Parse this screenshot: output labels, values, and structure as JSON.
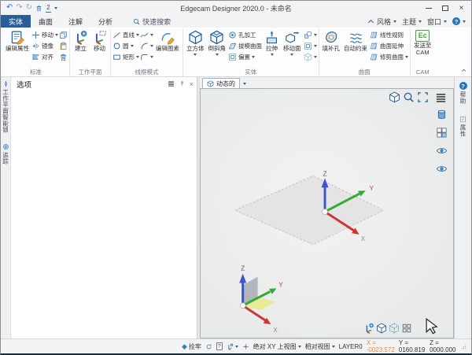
{
  "window": {
    "title": "Edgecam Designer 2020.0 - 未命名"
  },
  "icons": {
    "undo": "↶",
    "redo": "↷",
    "repeat": "↻",
    "two": "2",
    "close": "×",
    "help": "?",
    "ec": "Ec",
    "diamond": "◆"
  },
  "menu_tabs": {
    "items": [
      "实体",
      "曲面",
      "注解",
      "分析"
    ],
    "active": "实体"
  },
  "search": {
    "label": "快速搜索"
  },
  "window_menus": {
    "style": "风格",
    "theme": "主题",
    "window": "窗口"
  },
  "ribbon": {
    "standard": {
      "label": "标准",
      "edit_properties": "编辑属性",
      "move": "移动",
      "mirror": "镜像",
      "align": "对齐"
    },
    "workplane": {
      "label": "工作平面",
      "create": "建立",
      "move": "移动"
    },
    "wireframe": {
      "label": "线框模式",
      "line": "直线",
      "circle": "圆",
      "rect": "矩形",
      "edit_element": "编辑图素"
    },
    "solid": {
      "label": "实体",
      "cube": "立方体",
      "chamfer": "倒斜角",
      "hole": "孔加工",
      "draft": "拔模曲面",
      "offset": "偏置",
      "extrude": "拉伸",
      "move_face": "移动面"
    },
    "surface": {
      "label": "曲面",
      "fill_hole": "填补孔",
      "auto_constrain": "自动约束",
      "linear_rule": "线性规则",
      "surface_extend": "曲面延伸",
      "trim_surface": "修剪曲面"
    },
    "cam": {
      "label": "CAM",
      "send1": "发送至",
      "send2": "CAM"
    }
  },
  "left_panel": {
    "title": "选项",
    "tab_workplane": "工作平面智能锁",
    "tab_track": "追踪"
  },
  "viewport": {
    "tab": "动态的",
    "axis_x": "X",
    "axis_y": "Y",
    "axis_z": "Z"
  },
  "right_panel": {
    "help": "帮助",
    "properties": "属性"
  },
  "status_bar": {
    "snap": "拴牢",
    "abs_view": "绝对 XY 上视图",
    "rel_view": "相对视图",
    "layer": "LAYER0",
    "x": "X = -0023.572",
    "y": "Y = 0160.819",
    "z": "Z = 0000.000"
  }
}
